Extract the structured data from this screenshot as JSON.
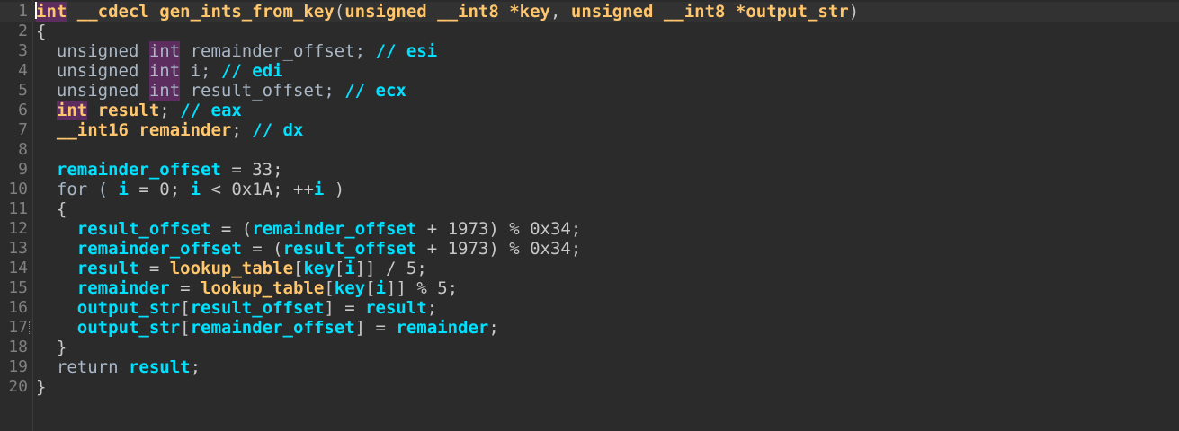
{
  "editor": {
    "colors": {
      "background": "#2b2b2b",
      "line_numbers": "#808080",
      "keyword": "#ffc66d",
      "identifier": "#00e0ff",
      "plain": "#a9b7c6",
      "highlight": "#5c2d5e"
    },
    "lines": [
      {
        "num": "1",
        "tokens": [
          {
            "text": "int",
            "cls": "kw hl"
          },
          {
            "text": " __cdecl ",
            "cls": "kw"
          },
          {
            "text": "gen_ints_from_key",
            "cls": "fn"
          },
          {
            "text": "(",
            "cls": "op"
          },
          {
            "text": "unsigned __int8 *key",
            "cls": "kw"
          },
          {
            "text": ", ",
            "cls": "op"
          },
          {
            "text": "unsigned __int8 *output_str",
            "cls": "kw"
          },
          {
            "text": ")",
            "cls": "op"
          }
        ]
      },
      {
        "num": "2",
        "tokens": [
          {
            "text": "{",
            "cls": "op"
          }
        ]
      },
      {
        "num": "3",
        "tokens": [
          {
            "text": "  unsigned ",
            "cls": "var"
          },
          {
            "text": "int",
            "cls": "var hl"
          },
          {
            "text": " remainder_offset; ",
            "cls": "var"
          },
          {
            "text": "// esi",
            "cls": "cm"
          }
        ]
      },
      {
        "num": "4",
        "tokens": [
          {
            "text": "  unsigned ",
            "cls": "var"
          },
          {
            "text": "int",
            "cls": "var hl"
          },
          {
            "text": " i; ",
            "cls": "var"
          },
          {
            "text": "// edi",
            "cls": "cm"
          }
        ]
      },
      {
        "num": "5",
        "tokens": [
          {
            "text": "  unsigned ",
            "cls": "var"
          },
          {
            "text": "int",
            "cls": "var hl"
          },
          {
            "text": " result_offset; ",
            "cls": "var"
          },
          {
            "text": "// ecx",
            "cls": "cm"
          }
        ]
      },
      {
        "num": "6",
        "tokens": [
          {
            "text": "  ",
            "cls": "var"
          },
          {
            "text": "int",
            "cls": "kw hl"
          },
          {
            "text": " result",
            "cls": "kw"
          },
          {
            "text": "; ",
            "cls": "op"
          },
          {
            "text": "// eax",
            "cls": "cm"
          }
        ]
      },
      {
        "num": "7",
        "tokens": [
          {
            "text": "  __int16 remainder",
            "cls": "kw"
          },
          {
            "text": "; ",
            "cls": "op"
          },
          {
            "text": "// dx",
            "cls": "cm"
          }
        ]
      },
      {
        "num": "8",
        "tokens": []
      },
      {
        "num": "9",
        "tokens": [
          {
            "text": "  ",
            "cls": "var"
          },
          {
            "text": "remainder_offset",
            "cls": "id"
          },
          {
            "text": " = 33;",
            "cls": "op"
          }
        ]
      },
      {
        "num": "10",
        "tokens": [
          {
            "text": "  for ( ",
            "cls": "var"
          },
          {
            "text": "i",
            "cls": "id"
          },
          {
            "text": " = 0; ",
            "cls": "op"
          },
          {
            "text": "i",
            "cls": "id"
          },
          {
            "text": " < 0x1A; ++",
            "cls": "op"
          },
          {
            "text": "i",
            "cls": "id"
          },
          {
            "text": " )",
            "cls": "op"
          }
        ]
      },
      {
        "num": "11",
        "tokens": [
          {
            "text": "  {",
            "cls": "op"
          }
        ]
      },
      {
        "num": "12",
        "tokens": [
          {
            "text": "    ",
            "cls": "var"
          },
          {
            "text": "result_offset",
            "cls": "id"
          },
          {
            "text": " = (",
            "cls": "op"
          },
          {
            "text": "remainder_offset",
            "cls": "id"
          },
          {
            "text": " + 1973) % 0x34;",
            "cls": "op"
          }
        ]
      },
      {
        "num": "13",
        "tokens": [
          {
            "text": "    ",
            "cls": "var"
          },
          {
            "text": "remainder_offset",
            "cls": "id"
          },
          {
            "text": " = (",
            "cls": "op"
          },
          {
            "text": "result_offset",
            "cls": "id"
          },
          {
            "text": " + 1973) % 0x34;",
            "cls": "op"
          }
        ]
      },
      {
        "num": "14",
        "tokens": [
          {
            "text": "    ",
            "cls": "var"
          },
          {
            "text": "result",
            "cls": "id"
          },
          {
            "text": " = ",
            "cls": "op"
          },
          {
            "text": "lookup_table",
            "cls": "fn"
          },
          {
            "text": "[",
            "cls": "op"
          },
          {
            "text": "key",
            "cls": "id"
          },
          {
            "text": "[",
            "cls": "op"
          },
          {
            "text": "i",
            "cls": "id"
          },
          {
            "text": "]] / 5;",
            "cls": "op"
          }
        ]
      },
      {
        "num": "15",
        "tokens": [
          {
            "text": "    ",
            "cls": "var"
          },
          {
            "text": "remainder",
            "cls": "id"
          },
          {
            "text": " = ",
            "cls": "op"
          },
          {
            "text": "lookup_table",
            "cls": "fn"
          },
          {
            "text": "[",
            "cls": "op"
          },
          {
            "text": "key",
            "cls": "id"
          },
          {
            "text": "[",
            "cls": "op"
          },
          {
            "text": "i",
            "cls": "id"
          },
          {
            "text": "]] % 5;",
            "cls": "op"
          }
        ]
      },
      {
        "num": "16",
        "tokens": [
          {
            "text": "    ",
            "cls": "var"
          },
          {
            "text": "output_str",
            "cls": "id"
          },
          {
            "text": "[",
            "cls": "op"
          },
          {
            "text": "result_offset",
            "cls": "id"
          },
          {
            "text": "] = ",
            "cls": "op"
          },
          {
            "text": "result",
            "cls": "id"
          },
          {
            "text": ";",
            "cls": "op"
          }
        ]
      },
      {
        "num": "17",
        "marker": true,
        "tokens": [
          {
            "text": "    ",
            "cls": "var"
          },
          {
            "text": "output_str",
            "cls": "id"
          },
          {
            "text": "[",
            "cls": "op"
          },
          {
            "text": "remainder_offset",
            "cls": "id"
          },
          {
            "text": "] = ",
            "cls": "op"
          },
          {
            "text": "remainder",
            "cls": "id"
          },
          {
            "text": ";",
            "cls": "op"
          }
        ]
      },
      {
        "num": "18",
        "tokens": [
          {
            "text": "  }",
            "cls": "op"
          }
        ]
      },
      {
        "num": "19",
        "tokens": [
          {
            "text": "  return ",
            "cls": "var"
          },
          {
            "text": "result",
            "cls": "id"
          },
          {
            "text": ";",
            "cls": "op"
          }
        ]
      },
      {
        "num": "20",
        "tokens": [
          {
            "text": "}",
            "cls": "op"
          }
        ]
      }
    ]
  }
}
